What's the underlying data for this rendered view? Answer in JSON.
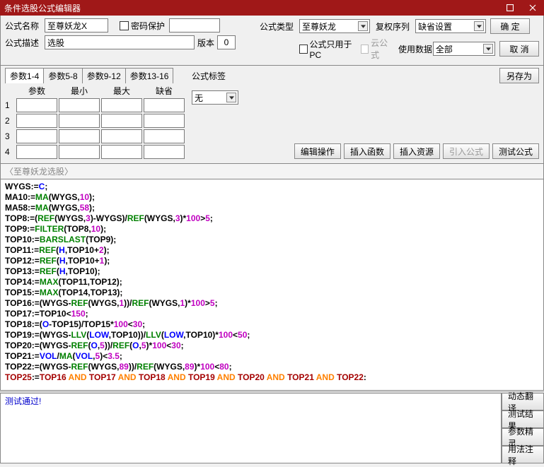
{
  "title": "条件选股公式编辑器",
  "labels": {
    "name": "公式名称",
    "pwd": "密码保护",
    "desc": "公式描述",
    "ver": "版本",
    "type": "公式类型",
    "fq": "复权序列",
    "pcOnly": "公式只用于PC",
    "cloud": "云公式",
    "useData": "使用数据",
    "tag": "公式标签"
  },
  "fields": {
    "name": "至尊妖龙X",
    "desc": "选股",
    "ver": "0",
    "type": "至尊妖龙",
    "fq": "缺省设置",
    "useData": "全部",
    "tag": "无"
  },
  "buttons": {
    "ok": "确 定",
    "cancel": "取 消",
    "saveAs": "另存为",
    "editOp": "编辑操作",
    "insFunc": "插入函数",
    "insRes": "插入资源",
    "import": "引入公式",
    "test": "测试公式"
  },
  "paramTabs": [
    "参数1-4",
    "参数5-8",
    "参数9-12",
    "参数13-16"
  ],
  "paramHeaders": [
    "参数",
    "最小",
    "最大",
    "缺省"
  ],
  "paramRows": [
    "1",
    "2",
    "3",
    "4"
  ],
  "editorTitle": "〈至尊妖龙选股〉",
  "status": "测试通过!",
  "sideButtons": [
    "动态翻译",
    "测试结果",
    "参数精灵",
    "用法注释"
  ],
  "code": [
    [
      [
        "b",
        "WYGS:="
      ],
      [
        "blu",
        "C"
      ],
      [
        "b",
        ";"
      ]
    ],
    [
      [
        "b",
        "MA10:="
      ],
      [
        "grn",
        "MA"
      ],
      [
        "b",
        "(WYGS,"
      ],
      [
        "mag",
        "10"
      ],
      [
        "b",
        ");"
      ]
    ],
    [
      [
        "b",
        "MA58:="
      ],
      [
        "grn",
        "MA"
      ],
      [
        "b",
        "(WYGS,"
      ],
      [
        "mag",
        "58"
      ],
      [
        "b",
        ");"
      ]
    ],
    [
      [
        "b",
        "TOP8:=("
      ],
      [
        "grn",
        "REF"
      ],
      [
        "b",
        "(WYGS,"
      ],
      [
        "mag",
        "3"
      ],
      [
        "b",
        ")-WYGS)/"
      ],
      [
        "grn",
        "REF"
      ],
      [
        "b",
        "(WYGS,"
      ],
      [
        "mag",
        "3"
      ],
      [
        "b",
        ")*"
      ],
      [
        "mag",
        "100"
      ],
      [
        "b",
        ">"
      ],
      [
        "mag",
        "5"
      ],
      [
        "b",
        ";"
      ]
    ],
    [
      [
        "b",
        "TOP9:="
      ],
      [
        "grn",
        "FILTER"
      ],
      [
        "b",
        "(TOP8,"
      ],
      [
        "mag",
        "10"
      ],
      [
        "b",
        ");"
      ]
    ],
    [
      [
        "b",
        "TOP10:="
      ],
      [
        "grn",
        "BARSLAST"
      ],
      [
        "b",
        "(TOP9);"
      ]
    ],
    [
      [
        "b",
        "TOP11:="
      ],
      [
        "grn",
        "REF"
      ],
      [
        "b",
        "("
      ],
      [
        "blu",
        "H"
      ],
      [
        "b",
        ",TOP10+"
      ],
      [
        "mag",
        "2"
      ],
      [
        "b",
        ");"
      ]
    ],
    [
      [
        "b",
        "TOP12:="
      ],
      [
        "grn",
        "REF"
      ],
      [
        "b",
        "("
      ],
      [
        "blu",
        "H"
      ],
      [
        "b",
        ",TOP10+"
      ],
      [
        "mag",
        "1"
      ],
      [
        "b",
        ");"
      ]
    ],
    [
      [
        "b",
        "TOP13:="
      ],
      [
        "grn",
        "REF"
      ],
      [
        "b",
        "("
      ],
      [
        "blu",
        "H"
      ],
      [
        "b",
        ",TOP10);"
      ]
    ],
    [
      [
        "b",
        "TOP14:="
      ],
      [
        "grn",
        "MAX"
      ],
      [
        "b",
        "(TOP11,TOP12);"
      ]
    ],
    [
      [
        "b",
        "TOP15:="
      ],
      [
        "grn",
        "MAX"
      ],
      [
        "b",
        "(TOP14,TOP13);"
      ]
    ],
    [
      [
        "b",
        "TOP16:=(WYGS-"
      ],
      [
        "grn",
        "REF"
      ],
      [
        "b",
        "(WYGS,"
      ],
      [
        "mag",
        "1"
      ],
      [
        "b",
        "))/"
      ],
      [
        "grn",
        "REF"
      ],
      [
        "b",
        "(WYGS,"
      ],
      [
        "mag",
        "1"
      ],
      [
        "b",
        ")*"
      ],
      [
        "mag",
        "100"
      ],
      [
        "b",
        ">"
      ],
      [
        "mag",
        "5"
      ],
      [
        "b",
        ";"
      ]
    ],
    [
      [
        "b",
        "TOP17:=TOP10<"
      ],
      [
        "mag",
        "150"
      ],
      [
        "b",
        ";"
      ]
    ],
    [
      [
        "b",
        "TOP18:=("
      ],
      [
        "blu",
        "O"
      ],
      [
        "b",
        "-TOP15)/TOP15*"
      ],
      [
        "mag",
        "100"
      ],
      [
        "b",
        "<"
      ],
      [
        "mag",
        "30"
      ],
      [
        "b",
        ";"
      ]
    ],
    [
      [
        "b",
        "TOP19:=(WYGS-"
      ],
      [
        "grn",
        "LLV"
      ],
      [
        "b",
        "("
      ],
      [
        "blu",
        "LOW"
      ],
      [
        "b",
        ",TOP10))/"
      ],
      [
        "grn",
        "LLV"
      ],
      [
        "b",
        "("
      ],
      [
        "blu",
        "LOW"
      ],
      [
        "b",
        ",TOP10)*"
      ],
      [
        "mag",
        "100"
      ],
      [
        "b",
        "<"
      ],
      [
        "mag",
        "50"
      ],
      [
        "b",
        ";"
      ]
    ],
    [
      [
        "b",
        "TOP20:=(WYGS-"
      ],
      [
        "grn",
        "REF"
      ],
      [
        "b",
        "("
      ],
      [
        "blu",
        "O"
      ],
      [
        "b",
        ","
      ],
      [
        "mag",
        "5"
      ],
      [
        "b",
        "))/"
      ],
      [
        "grn",
        "REF"
      ],
      [
        "b",
        "("
      ],
      [
        "blu",
        "O"
      ],
      [
        "b",
        ","
      ],
      [
        "mag",
        "5"
      ],
      [
        "b",
        ")*"
      ],
      [
        "mag",
        "100"
      ],
      [
        "b",
        "<"
      ],
      [
        "mag",
        "30"
      ],
      [
        "b",
        ";"
      ]
    ],
    [
      [
        "b",
        "TOP21:="
      ],
      [
        "blu",
        "VOL"
      ],
      [
        "b",
        "/"
      ],
      [
        "grn",
        "MA"
      ],
      [
        "b",
        "("
      ],
      [
        "blu",
        "VOL"
      ],
      [
        "b",
        ","
      ],
      [
        "mag",
        "5"
      ],
      [
        "b",
        ")<"
      ],
      [
        "mag",
        "3.5"
      ],
      [
        "b",
        ";"
      ]
    ],
    [
      [
        "b",
        "TOP22:=(WYGS-"
      ],
      [
        "grn",
        "REF"
      ],
      [
        "b",
        "(WYGS,"
      ],
      [
        "mag",
        "89"
      ],
      [
        "b",
        "))/"
      ],
      [
        "grn",
        "REF"
      ],
      [
        "b",
        "(WYGS,"
      ],
      [
        "mag",
        "89"
      ],
      [
        "b",
        ")*"
      ],
      [
        "mag",
        "100"
      ],
      [
        "b",
        "<"
      ],
      [
        "mag",
        "80"
      ],
      [
        "b",
        ";"
      ]
    ],
    [
      [
        "red",
        "TOP25"
      ],
      [
        "b",
        ":="
      ],
      [
        "red",
        "TOP16"
      ],
      [
        "b",
        " "
      ],
      [
        "org",
        "AND"
      ],
      [
        "b",
        " "
      ],
      [
        "red",
        "TOP17"
      ],
      [
        "b",
        " "
      ],
      [
        "org",
        "AND"
      ],
      [
        "b",
        " "
      ],
      [
        "red",
        "TOP18"
      ],
      [
        "b",
        " "
      ],
      [
        "org",
        "AND"
      ],
      [
        "b",
        " "
      ],
      [
        "red",
        "TOP19"
      ],
      [
        "b",
        " "
      ],
      [
        "org",
        "AND"
      ],
      [
        "b",
        " "
      ],
      [
        "red",
        "TOP20"
      ],
      [
        "b",
        " "
      ],
      [
        "org",
        "AND"
      ],
      [
        "b",
        " "
      ],
      [
        "red",
        "TOP21"
      ],
      [
        "b",
        " "
      ],
      [
        "org",
        "AND"
      ],
      [
        "b",
        " "
      ],
      [
        "red",
        "TOP22"
      ],
      [
        "b",
        ":"
      ]
    ]
  ]
}
